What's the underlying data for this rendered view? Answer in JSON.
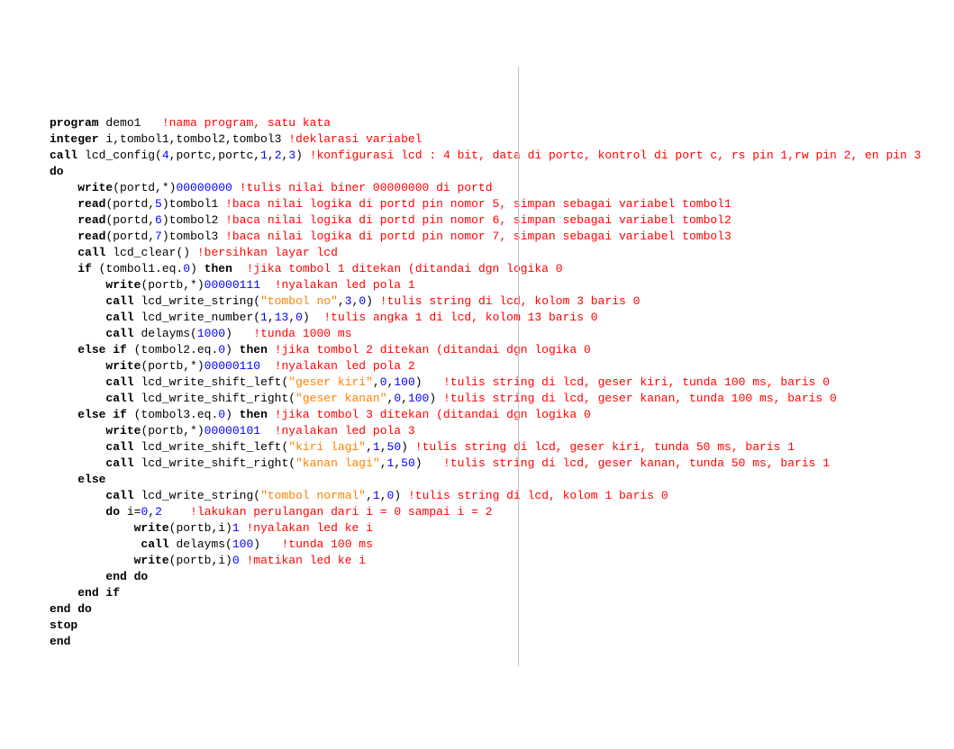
{
  "code": {
    "lines": [
      [
        [
          "kw",
          "program"
        ],
        [
          "ident",
          " demo1   "
        ],
        [
          "cmt",
          "!nama program, satu kata"
        ]
      ],
      [
        [
          "kw",
          "integer"
        ],
        [
          "ident",
          " i,tombol1,tombol2,tombol3 "
        ],
        [
          "cmt",
          "!deklarasi variabel"
        ]
      ],
      [
        [
          "kw",
          "call"
        ],
        [
          "ident",
          " lcd_config("
        ],
        [
          "num",
          "4"
        ],
        [
          "ident",
          ",portc,portc,"
        ],
        [
          "num",
          "1"
        ],
        [
          "ident",
          ","
        ],
        [
          "num",
          "2"
        ],
        [
          "ident",
          ","
        ],
        [
          "num",
          "3"
        ],
        [
          "ident",
          ") "
        ],
        [
          "cmt",
          "!konfigurasi lcd : 4 bit, data di portc, kontrol di port c, rs pin 1,rw pin 2, en pin 3"
        ]
      ],
      [
        [
          "kw",
          "do"
        ]
      ],
      [
        [
          "ident",
          "    "
        ],
        [
          "kw",
          "write"
        ],
        [
          "ident",
          "(portd,*)"
        ],
        [
          "num",
          "00000000"
        ],
        [
          "ident",
          " "
        ],
        [
          "cmt",
          "!tulis nilai biner 00000000 di portd"
        ]
      ],
      [
        [
          "ident",
          "    "
        ],
        [
          "kw",
          "read"
        ],
        [
          "ident",
          "(portd,"
        ],
        [
          "num",
          "5"
        ],
        [
          "ident",
          ")tombol1 "
        ],
        [
          "cmt",
          "!baca nilai logika di portd pin nomor 5, simpan sebagai variabel tombol1"
        ]
      ],
      [
        [
          "ident",
          "    "
        ],
        [
          "kw",
          "read"
        ],
        [
          "ident",
          "(portd,"
        ],
        [
          "num",
          "6"
        ],
        [
          "ident",
          ")tombol2 "
        ],
        [
          "cmt",
          "!baca nilai logika di portd pin nomor 6, simpan sebagai variabel tombol2"
        ]
      ],
      [
        [
          "ident",
          "    "
        ],
        [
          "kw",
          "read"
        ],
        [
          "ident",
          "(portd,"
        ],
        [
          "num",
          "7"
        ],
        [
          "ident",
          ")tombol3 "
        ],
        [
          "cmt",
          "!baca nilai logika di portd pin nomor 7, simpan sebagai variabel tombol3"
        ]
      ],
      [
        [
          "ident",
          "    "
        ],
        [
          "kw",
          "call"
        ],
        [
          "ident",
          " lcd_clear() "
        ],
        [
          "cmt",
          "!bersihkan layar lcd"
        ]
      ],
      [
        [
          "ident",
          "    "
        ],
        [
          "kw",
          "if"
        ],
        [
          "ident",
          " (tombol1.eq."
        ],
        [
          "num",
          "0"
        ],
        [
          "ident",
          ") "
        ],
        [
          "kw",
          "then"
        ],
        [
          "ident",
          "  "
        ],
        [
          "cmt",
          "!jika tombol 1 ditekan (ditandai dgn logika 0"
        ]
      ],
      [
        [
          "ident",
          "        "
        ],
        [
          "kw",
          "write"
        ],
        [
          "ident",
          "(portb,*)"
        ],
        [
          "num",
          "00000111"
        ],
        [
          "ident",
          "  "
        ],
        [
          "cmt",
          "!nyalakan led pola 1"
        ]
      ],
      [
        [
          "ident",
          "        "
        ],
        [
          "kw",
          "call"
        ],
        [
          "ident",
          " lcd_write_string("
        ],
        [
          "str",
          "\"tombol no\""
        ],
        [
          "ident",
          ","
        ],
        [
          "num",
          "3"
        ],
        [
          "ident",
          ","
        ],
        [
          "num",
          "0"
        ],
        [
          "ident",
          ") "
        ],
        [
          "cmt",
          "!tulis string di lcd, kolom 3 baris 0"
        ]
      ],
      [
        [
          "ident",
          "        "
        ],
        [
          "kw",
          "call"
        ],
        [
          "ident",
          " lcd_write_number("
        ],
        [
          "num",
          "1"
        ],
        [
          "ident",
          ","
        ],
        [
          "num",
          "13"
        ],
        [
          "ident",
          ","
        ],
        [
          "num",
          "0"
        ],
        [
          "ident",
          ")  "
        ],
        [
          "cmt",
          "!tulis angka 1 di lcd, kolom 13 baris 0"
        ]
      ],
      [
        [
          "ident",
          "        "
        ],
        [
          "kw",
          "call"
        ],
        [
          "ident",
          " delayms("
        ],
        [
          "num",
          "1000"
        ],
        [
          "ident",
          ")   "
        ],
        [
          "cmt",
          "!tunda 1000 ms"
        ]
      ],
      [
        [
          "ident",
          "    "
        ],
        [
          "kw",
          "else if"
        ],
        [
          "ident",
          " (tombol2.eq."
        ],
        [
          "num",
          "0"
        ],
        [
          "ident",
          ") "
        ],
        [
          "kw",
          "then"
        ],
        [
          "ident",
          " "
        ],
        [
          "cmt",
          "!jika tombol 2 ditekan (ditandai dgn logika 0"
        ]
      ],
      [
        [
          "ident",
          "        "
        ],
        [
          "kw",
          "write"
        ],
        [
          "ident",
          "(portb,*)"
        ],
        [
          "num",
          "00000110"
        ],
        [
          "ident",
          "  "
        ],
        [
          "cmt",
          "!nyalakan led pola 2"
        ]
      ],
      [
        [
          "ident",
          "        "
        ],
        [
          "kw",
          "call"
        ],
        [
          "ident",
          " lcd_write_shift_left("
        ],
        [
          "str",
          "\"geser kiri\""
        ],
        [
          "ident",
          ","
        ],
        [
          "num",
          "0"
        ],
        [
          "ident",
          ","
        ],
        [
          "num",
          "100"
        ],
        [
          "ident",
          ")   "
        ],
        [
          "cmt",
          "!tulis string di lcd, geser kiri, tunda 100 ms, baris 0"
        ]
      ],
      [
        [
          "ident",
          "        "
        ],
        [
          "kw",
          "call"
        ],
        [
          "ident",
          " lcd_write_shift_right("
        ],
        [
          "str",
          "\"geser kanan\""
        ],
        [
          "ident",
          ","
        ],
        [
          "num",
          "0"
        ],
        [
          "ident",
          ","
        ],
        [
          "num",
          "100"
        ],
        [
          "ident",
          ") "
        ],
        [
          "cmt",
          "!tulis string di lcd, geser kanan, tunda 100 ms, baris 0"
        ]
      ],
      [
        [
          "ident",
          "    "
        ],
        [
          "kw",
          "else if"
        ],
        [
          "ident",
          " (tombol3.eq."
        ],
        [
          "num",
          "0"
        ],
        [
          "ident",
          ") "
        ],
        [
          "kw",
          "then"
        ],
        [
          "ident",
          " "
        ],
        [
          "cmt",
          "!jika tombol 3 ditekan (ditandai dgn logika 0"
        ]
      ],
      [
        [
          "ident",
          "        "
        ],
        [
          "kw",
          "write"
        ],
        [
          "ident",
          "(portb,*)"
        ],
        [
          "num",
          "00000101"
        ],
        [
          "ident",
          "  "
        ],
        [
          "cmt",
          "!nyalakan led pola 3"
        ]
      ],
      [
        [
          "ident",
          "        "
        ],
        [
          "kw",
          "call"
        ],
        [
          "ident",
          " lcd_write_shift_left("
        ],
        [
          "str",
          "\"kiri lagi\""
        ],
        [
          "ident",
          ","
        ],
        [
          "num",
          "1"
        ],
        [
          "ident",
          ","
        ],
        [
          "num",
          "50"
        ],
        [
          "ident",
          ") "
        ],
        [
          "cmt",
          "!tulis string di lcd, geser kiri, tunda 50 ms, baris 1"
        ]
      ],
      [
        [
          "ident",
          "        "
        ],
        [
          "kw",
          "call"
        ],
        [
          "ident",
          " lcd_write_shift_right("
        ],
        [
          "str",
          "\"kanan lagi\""
        ],
        [
          "ident",
          ","
        ],
        [
          "num",
          "1"
        ],
        [
          "ident",
          ","
        ],
        [
          "num",
          "50"
        ],
        [
          "ident",
          ")   "
        ],
        [
          "cmt",
          "!tulis string di lcd, geser kanan, tunda 50 ms, baris 1"
        ]
      ],
      [
        [
          "ident",
          "    "
        ],
        [
          "kw",
          "else"
        ]
      ],
      [
        [
          "ident",
          "        "
        ],
        [
          "kw",
          "call"
        ],
        [
          "ident",
          " lcd_write_string("
        ],
        [
          "str",
          "\"tombol normal\""
        ],
        [
          "ident",
          ","
        ],
        [
          "num",
          "1"
        ],
        [
          "ident",
          ","
        ],
        [
          "num",
          "0"
        ],
        [
          "ident",
          ") "
        ],
        [
          "cmt",
          "!tulis string di lcd, kolom 1 baris 0"
        ]
      ],
      [
        [
          "ident",
          "        "
        ],
        [
          "kw",
          "do"
        ],
        [
          "ident",
          " i="
        ],
        [
          "num",
          "0"
        ],
        [
          "ident",
          ","
        ],
        [
          "num",
          "2"
        ],
        [
          "ident",
          "    "
        ],
        [
          "cmt",
          "!lakukan perulangan dari i = 0 sampai i = 2"
        ]
      ],
      [
        [
          "ident",
          "            "
        ],
        [
          "kw",
          "write"
        ],
        [
          "ident",
          "(portb,i)"
        ],
        [
          "num",
          "1"
        ],
        [
          "ident",
          " "
        ],
        [
          "cmt",
          "!nyalakan led ke i"
        ]
      ],
      [
        [
          "ident",
          "             "
        ],
        [
          "kw",
          "call"
        ],
        [
          "ident",
          " delayms("
        ],
        [
          "num",
          "100"
        ],
        [
          "ident",
          ")   "
        ],
        [
          "cmt",
          "!tunda 100 ms"
        ]
      ],
      [
        [
          "ident",
          "            "
        ],
        [
          "kw",
          "write"
        ],
        [
          "ident",
          "(portb,i)"
        ],
        [
          "num",
          "0"
        ],
        [
          "ident",
          " "
        ],
        [
          "cmt",
          "!matikan led ke i"
        ]
      ],
      [
        [
          "ident",
          "        "
        ],
        [
          "kw",
          "end do"
        ]
      ],
      [
        [
          "ident",
          "    "
        ],
        [
          "kw",
          "end if"
        ]
      ],
      [
        [
          "kw",
          "end do"
        ]
      ],
      [
        [
          "kw",
          "stop"
        ]
      ],
      [
        [
          "kw",
          "end"
        ]
      ]
    ]
  }
}
